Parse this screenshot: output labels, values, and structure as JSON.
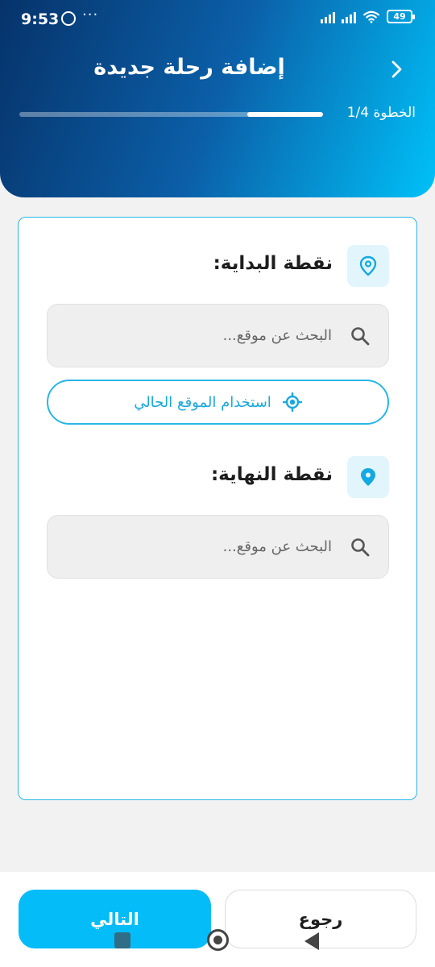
{
  "status_bar": {
    "time": "9:53",
    "dots": "···",
    "battery": "49"
  },
  "header": {
    "title": "إضافة رحلة جديدة",
    "step_label": "الخطوة 1/4",
    "progress_fraction": 0.25
  },
  "start_point": {
    "title": "نقطة البداية:",
    "search_placeholder": "البحث عن موقع...",
    "use_current_location": "استخدام الموقع الحالي"
  },
  "end_point": {
    "title": "نقطة النهاية:",
    "search_placeholder": "البحث عن موقع..."
  },
  "footer": {
    "next_label": "التالي",
    "back_label": "رجوع"
  },
  "colors": {
    "accent": "#03bcf8",
    "header_dark": "#06336a",
    "border": "#29b6e6"
  }
}
